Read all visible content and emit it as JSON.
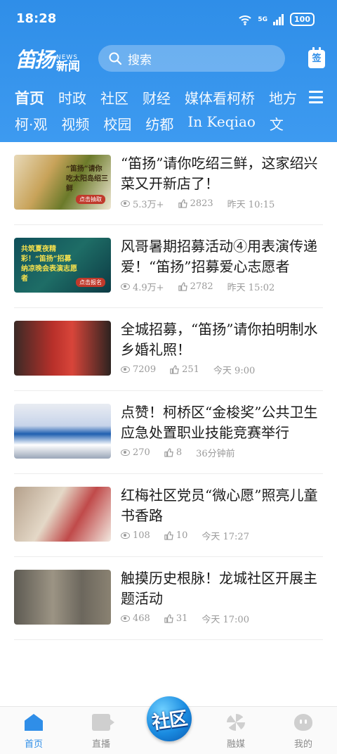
{
  "status_bar": {
    "time": "18:28",
    "network": "5G",
    "battery": "100"
  },
  "header": {
    "logo_main": "笛扬",
    "logo_en": "NEWS",
    "logo_sub": "新闻",
    "search_placeholder": "搜索",
    "sign_label": "签"
  },
  "nav": {
    "row1": [
      "首页",
      "时政",
      "社区",
      "财经",
      "媒体看柯桥",
      "地方"
    ],
    "row2": [
      "柯·观",
      "视频",
      "校园",
      "纺都",
      "In Keqiao",
      "文"
    ]
  },
  "feed": [
    {
      "title": "“笛扬”请你吃绍三鲜，这家绍兴菜又开新店了！",
      "views": "5.3万+",
      "likes": "2823",
      "time": "昨天 10:15",
      "thumb_text": "“笛扬”请你吃太阳岛绍三鲜",
      "thumb_tag": "点击抽取"
    },
    {
      "title": "风哥暑期招募活动④用表演传递爱！“笛扬”招募爱心志愿者",
      "views": "4.9万+",
      "likes": "2782",
      "time": "昨天 15:02",
      "thumb_text": "共筑夏夜精彩！“笛扬”招募纳凉晚会表演志愿者",
      "thumb_tag": "点击报名"
    },
    {
      "title": "全城招募，“笛扬”请你拍明制水乡婚礼照！",
      "views": "7209",
      "likes": "251",
      "time": "今天 9:00",
      "thumb_text": "",
      "thumb_tag": ""
    },
    {
      "title": "点赞！柯桥区“金梭奖”公共卫生应急处置职业技能竞赛举行",
      "views": "270",
      "likes": "8",
      "time": "36分钟前",
      "thumb_text": "",
      "thumb_tag": ""
    },
    {
      "title": "红梅社区党员“微心愿”照亮儿童书香路",
      "views": "108",
      "likes": "10",
      "time": "今天 17:27",
      "thumb_text": "",
      "thumb_tag": ""
    },
    {
      "title": "触摸历史根脉！龙城社区开展主题活动",
      "views": "468",
      "likes": "31",
      "time": "今天 17:00",
      "thumb_text": "",
      "thumb_tag": ""
    }
  ],
  "tabbar": {
    "home": "首页",
    "live": "直播",
    "community": "社区",
    "media": "融媒",
    "me": "我的"
  },
  "colors": {
    "accent": "#2f8ee8",
    "text": "#1a1a1a",
    "meta": "#9a9a9a"
  }
}
